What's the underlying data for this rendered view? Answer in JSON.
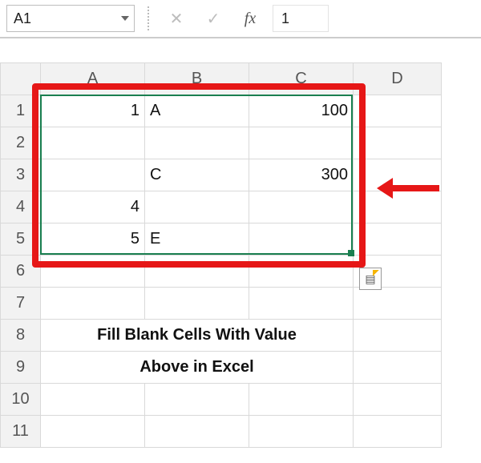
{
  "formula_bar": {
    "name_box_value": "A1",
    "cancel_tooltip": "Cancel",
    "enter_tooltip": "Enter",
    "fx_label": "fx",
    "cell_value": "1"
  },
  "columns": {
    "A": "A",
    "B": "B",
    "C": "C",
    "D": "D"
  },
  "rows": [
    "1",
    "2",
    "3",
    "4",
    "5",
    "6",
    "7",
    "8",
    "9",
    "10",
    "11"
  ],
  "cells": {
    "A1": "1",
    "B1": "A",
    "C1": "100",
    "A2": "",
    "B2": "",
    "C2": "",
    "A3": "",
    "B3": "C",
    "C3": "300",
    "A4": "4",
    "B4": "",
    "C4": "",
    "A5": "5",
    "B5": "E",
    "C5": ""
  },
  "banner": {
    "line1": "Fill Blank Cells With Value",
    "line2": "Above in Excel"
  },
  "icons": {
    "dropdown": "chevron-down-icon",
    "cancel": "x-icon",
    "enter": "check-icon",
    "fx": "fx-icon",
    "quick_analysis": "quick-analysis-icon"
  }
}
